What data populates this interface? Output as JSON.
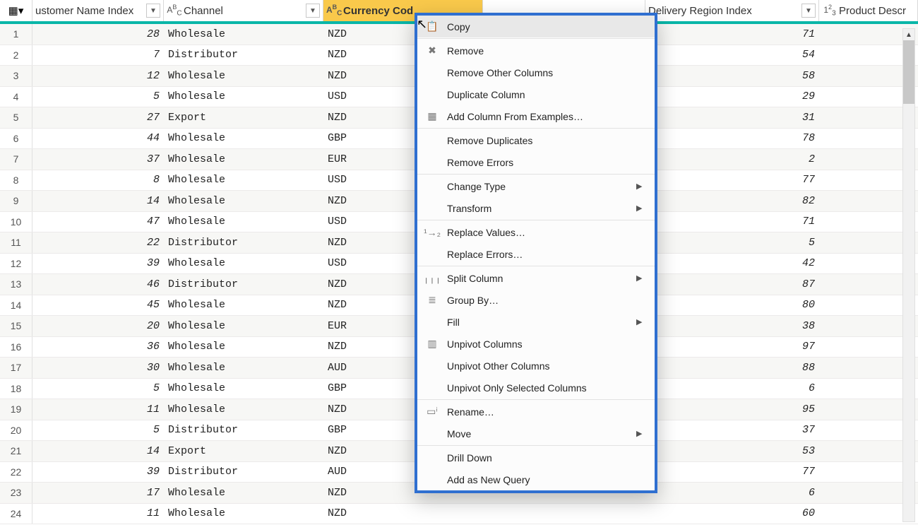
{
  "columns": {
    "c1": {
      "label": "ustomer Name Index",
      "type": "num"
    },
    "c2": {
      "label": "Channel",
      "type": "text"
    },
    "c3": {
      "label": "Currency Cod",
      "type": "text",
      "selected": true
    },
    "c4": {
      "label": "Delivery Region Index",
      "type": "num"
    },
    "c5": {
      "label": "Product Descr",
      "type": "num"
    }
  },
  "rows": [
    {
      "n": "1",
      "idx": "28",
      "chan": "Wholesale",
      "curr": "NZD",
      "reg": "71"
    },
    {
      "n": "2",
      "idx": "7",
      "chan": "Distributor",
      "curr": "NZD",
      "reg": "54"
    },
    {
      "n": "3",
      "idx": "12",
      "chan": "Wholesale",
      "curr": "NZD",
      "reg": "58"
    },
    {
      "n": "4",
      "idx": "5",
      "chan": "Wholesale",
      "curr": "USD",
      "reg": "29"
    },
    {
      "n": "5",
      "idx": "27",
      "chan": "Export",
      "curr": "NZD",
      "reg": "31"
    },
    {
      "n": "6",
      "idx": "44",
      "chan": "Wholesale",
      "curr": "GBP",
      "reg": "78"
    },
    {
      "n": "7",
      "idx": "37",
      "chan": "Wholesale",
      "curr": "EUR",
      "reg": "2"
    },
    {
      "n": "8",
      "idx": "8",
      "chan": "Wholesale",
      "curr": "USD",
      "reg": "77"
    },
    {
      "n": "9",
      "idx": "14",
      "chan": "Wholesale",
      "curr": "NZD",
      "reg": "82"
    },
    {
      "n": "10",
      "idx": "47",
      "chan": "Wholesale",
      "curr": "USD",
      "reg": "71"
    },
    {
      "n": "11",
      "idx": "22",
      "chan": "Distributor",
      "curr": "NZD",
      "reg": "5"
    },
    {
      "n": "12",
      "idx": "39",
      "chan": "Wholesale",
      "curr": "USD",
      "reg": "42"
    },
    {
      "n": "13",
      "idx": "46",
      "chan": "Distributor",
      "curr": "NZD",
      "reg": "87"
    },
    {
      "n": "14",
      "idx": "45",
      "chan": "Wholesale",
      "curr": "NZD",
      "reg": "80"
    },
    {
      "n": "15",
      "idx": "20",
      "chan": "Wholesale",
      "curr": "EUR",
      "reg": "38"
    },
    {
      "n": "16",
      "idx": "36",
      "chan": "Wholesale",
      "curr": "NZD",
      "reg": "97"
    },
    {
      "n": "17",
      "idx": "30",
      "chan": "Wholesale",
      "curr": "AUD",
      "reg": "88"
    },
    {
      "n": "18",
      "idx": "5",
      "chan": "Wholesale",
      "curr": "GBP",
      "reg": "6"
    },
    {
      "n": "19",
      "idx": "11",
      "chan": "Wholesale",
      "curr": "NZD",
      "reg": "95"
    },
    {
      "n": "20",
      "idx": "5",
      "chan": "Distributor",
      "curr": "GBP",
      "reg": "37"
    },
    {
      "n": "21",
      "idx": "14",
      "chan": "Export",
      "curr": "NZD",
      "reg": "53"
    },
    {
      "n": "22",
      "idx": "39",
      "chan": "Distributor",
      "curr": "AUD",
      "reg": "77"
    },
    {
      "n": "23",
      "idx": "17",
      "chan": "Wholesale",
      "curr": "NZD",
      "reg": "6"
    },
    {
      "n": "24",
      "idx": "11",
      "chan": "Wholesale",
      "curr": "NZD",
      "reg": "60"
    }
  ],
  "menu": [
    {
      "icon": "copy",
      "label": "Copy",
      "type": "item",
      "hover": true
    },
    {
      "type": "sep"
    },
    {
      "icon": "remove",
      "label": "Remove",
      "type": "item"
    },
    {
      "label": "Remove Other Columns",
      "type": "item"
    },
    {
      "label": "Duplicate Column",
      "type": "item"
    },
    {
      "icon": "addcol",
      "label": "Add Column From Examples…",
      "type": "item"
    },
    {
      "type": "sep"
    },
    {
      "label": "Remove Duplicates",
      "type": "item"
    },
    {
      "label": "Remove Errors",
      "type": "item"
    },
    {
      "type": "sep"
    },
    {
      "label": "Change Type",
      "type": "sub"
    },
    {
      "label": "Transform",
      "type": "sub"
    },
    {
      "type": "sep"
    },
    {
      "icon": "replace",
      "label": "Replace Values…",
      "type": "item"
    },
    {
      "label": "Replace Errors…",
      "type": "item"
    },
    {
      "type": "sep"
    },
    {
      "icon": "split",
      "label": "Split Column",
      "type": "sub"
    },
    {
      "icon": "group",
      "label": "Group By…",
      "type": "item"
    },
    {
      "label": "Fill",
      "type": "sub"
    },
    {
      "icon": "unpivot",
      "label": "Unpivot Columns",
      "type": "item"
    },
    {
      "label": "Unpivot Other Columns",
      "type": "item"
    },
    {
      "label": "Unpivot Only Selected Columns",
      "type": "item"
    },
    {
      "type": "sep"
    },
    {
      "icon": "rename",
      "label": "Rename…",
      "type": "item"
    },
    {
      "label": "Move",
      "type": "sub"
    },
    {
      "type": "sep"
    },
    {
      "label": "Drill Down",
      "type": "item"
    },
    {
      "label": "Add as New Query",
      "type": "item"
    }
  ],
  "icons": {
    "copy": "📋",
    "remove": "✖",
    "addcol": "▦",
    "replace": "¹→₂",
    "split": "╷╷╷",
    "group": "≣",
    "unpivot": "▥",
    "rename": "▭ⁱ"
  }
}
